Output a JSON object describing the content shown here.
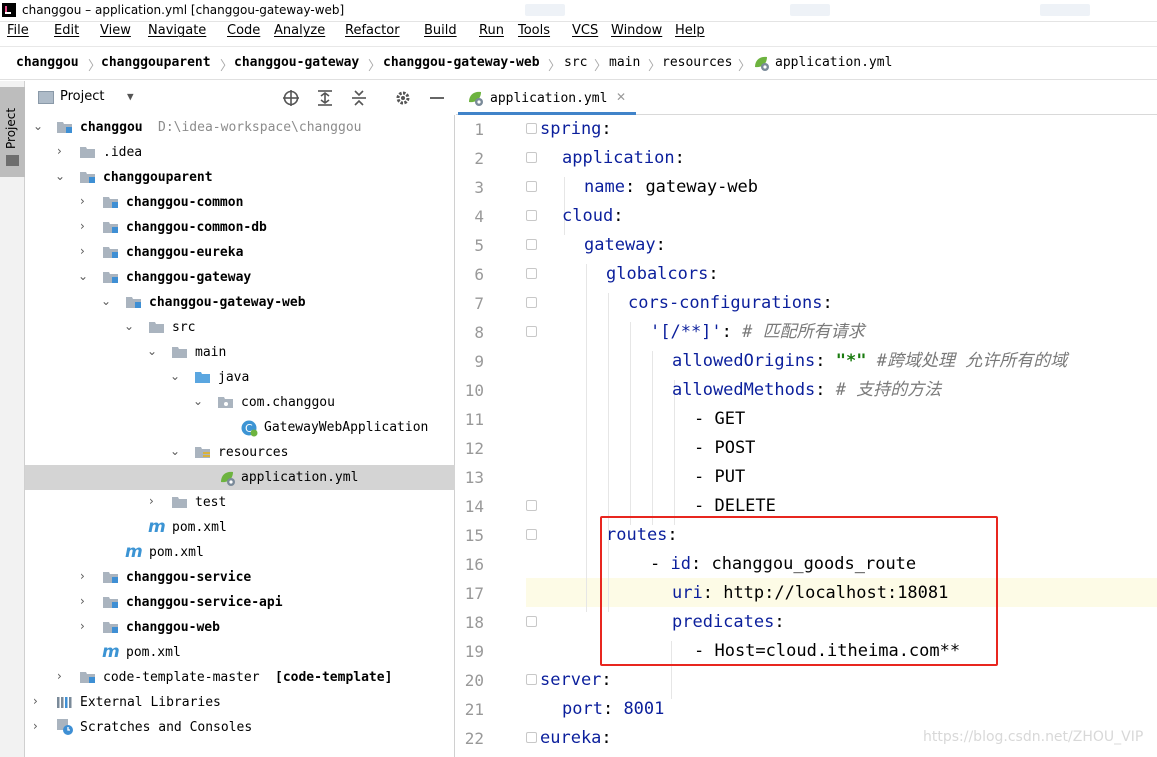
{
  "window": {
    "title": "changgou – application.yml [changgou-gateway-web]"
  },
  "menu": [
    "File",
    "Edit",
    "View",
    "Navigate",
    "Code",
    "Analyze",
    "Refactor",
    "Build",
    "Run",
    "Tools",
    "VCS",
    "Window",
    "Help"
  ],
  "breadcrumbs": [
    "changgou",
    "changgouparent",
    "changgou-gateway",
    "changgou-gateway-web",
    "src",
    "main",
    "resources",
    "application.yml"
  ],
  "toolwindow": {
    "strip_label": "Project",
    "title": "Project"
  },
  "tree": [
    {
      "label": "changgou",
      "path": "D:\\idea-workspace\\changgou"
    },
    {
      "label": ".idea"
    },
    {
      "label": "changgouparent"
    },
    {
      "label": "changgou-common"
    },
    {
      "label": "changgou-common-db"
    },
    {
      "label": "changgou-eureka"
    },
    {
      "label": "changgou-gateway"
    },
    {
      "label": "changgou-gateway-web"
    },
    {
      "label": "src"
    },
    {
      "label": "main"
    },
    {
      "label": "java"
    },
    {
      "label": "com.changgou"
    },
    {
      "label": "GatewayWebApplication"
    },
    {
      "label": "resources"
    },
    {
      "label": "application.yml"
    },
    {
      "label": "test"
    },
    {
      "label": "pom.xml"
    },
    {
      "label": "pom.xml"
    },
    {
      "label": "changgou-service"
    },
    {
      "label": "changgou-service-api"
    },
    {
      "label": "changgou-web"
    },
    {
      "label": "pom.xml"
    },
    {
      "label": "code-template-master",
      "extra": "[code-template]"
    },
    {
      "label": "External Libraries"
    },
    {
      "label": "Scratches and Consoles"
    }
  ],
  "editor": {
    "tab": "application.yml",
    "line_numbers": [
      "1",
      "2",
      "3",
      "4",
      "5",
      "6",
      "7",
      "8",
      "9",
      "10",
      "11",
      "12",
      "13",
      "14",
      "15",
      "16",
      "17",
      "18",
      "19",
      "20",
      "21",
      "22"
    ],
    "current_line": "17",
    "code": {
      "l1_k": "spring",
      "l2_k": "application",
      "l3_k": "name",
      "l3_v": "gateway-web",
      "l4_k": "cloud",
      "l5_k": "gateway",
      "l6_k": "globalcors",
      "l7_k": "cors-configurations",
      "l8_k": "'[/**]'",
      "l8_c": "# 匹配所有请求",
      "l9_k": "allowedOrigins",
      "l9_v": "\"*\"",
      "l9_c": "#跨域处理 允许所有的域",
      "l10_k": "allowedMethods",
      "l10_c": "# 支持的方法",
      "l11_v": "- GET",
      "l12_v": "- POST",
      "l13_v": "- PUT",
      "l14_v": "- DELETE",
      "l15_k": "routes",
      "l16_dash": "- ",
      "l16_k": "id",
      "l16_v": "changgou_goods_route",
      "l17_k": "uri",
      "l17_v": "http://localhost:18081",
      "l18_k": "predicates",
      "l19_v": "- Host=cloud.itheima.com**",
      "l20_k": "server",
      "l21_k": "port",
      "l21_v": "8001",
      "l22_k": "eureka"
    }
  },
  "watermark": "https://blog.csdn.net/ZHOU_VIP"
}
